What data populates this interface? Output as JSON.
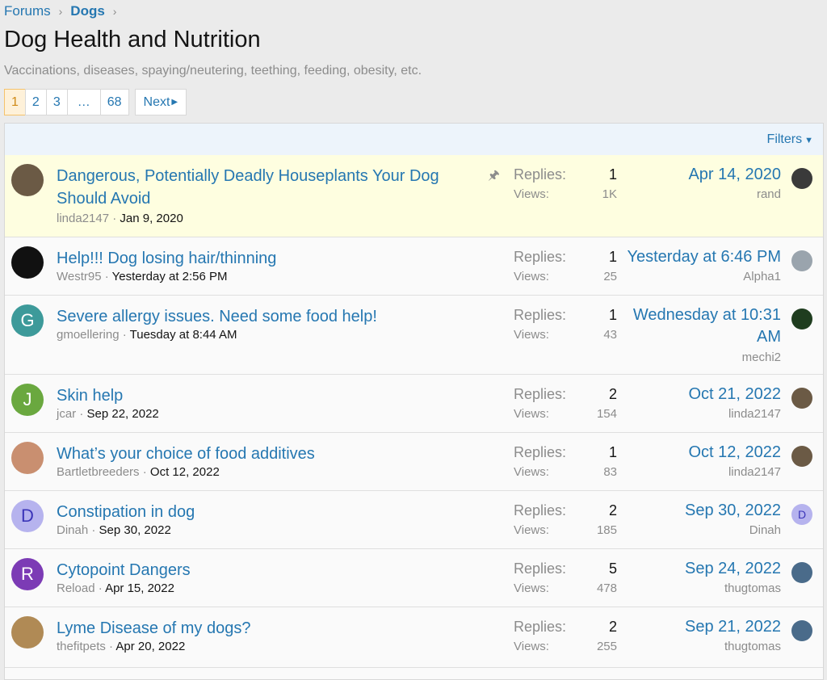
{
  "breadcrumb": {
    "forums": "Forums",
    "dogs": "Dogs",
    "sep": "›"
  },
  "page": {
    "title": "Dog Health and Nutrition",
    "description": "Vaccinations, diseases, spaying/neutering, teething, feeding, obesity, etc."
  },
  "pagination": {
    "pages": [
      "1",
      "2",
      "3",
      "…",
      "68"
    ],
    "current": "1",
    "next": "Next"
  },
  "filters": {
    "label": "Filters"
  },
  "labels": {
    "replies": "Replies:",
    "views": "Views:"
  },
  "threads": [
    {
      "title": "Dangerous, Potentially Deadly Houseplants Your Dog Should Avoid",
      "author": "linda2147",
      "date": "Jan 9, 2020",
      "replies": "1",
      "views": "1K",
      "last_date": "Apr 14, 2020",
      "last_user": "rand",
      "sticky": true,
      "avatar": {
        "letter": "",
        "color": "#6b5a45",
        "icon": "dog-photo-icon"
      },
      "last_avatar": {
        "letter": "",
        "color": "#3a3a3a",
        "icon": "pug-photo-icon"
      }
    },
    {
      "title": "Help!!! Dog losing hair/thinning",
      "author": "Westr95",
      "date": "Yesterday at 2:56 PM",
      "replies": "1",
      "views": "25",
      "last_date": "Yesterday at 6:46 PM",
      "last_user": "Alpha1",
      "sticky": false,
      "avatar": {
        "letter": "",
        "color": "#111111",
        "icon": "logo-avatar-icon"
      },
      "last_avatar": {
        "letter": "",
        "color": "#9aa4ad",
        "icon": "dog-photo-icon"
      }
    },
    {
      "title": "Severe allergy issues. Need some food help!",
      "author": "gmoellering",
      "date": "Tuesday at 8:44 AM",
      "replies": "1",
      "views": "43",
      "last_date": "Wednesday at 10:31 AM",
      "last_user": "mechi2",
      "sticky": false,
      "avatar": {
        "letter": "G",
        "color": "#3d9a9a",
        "icon": "letter-avatar-icon"
      },
      "last_avatar": {
        "letter": "",
        "color": "#1f3d1f",
        "icon": "dog-photo-icon"
      }
    },
    {
      "title": "Skin help",
      "author": "jcar",
      "date": "Sep 22, 2022",
      "replies": "2",
      "views": "154",
      "last_date": "Oct 21, 2022",
      "last_user": "linda2147",
      "sticky": false,
      "avatar": {
        "letter": "J",
        "color": "#6aa83f",
        "icon": "letter-avatar-icon"
      },
      "last_avatar": {
        "letter": "",
        "color": "#6b5a45",
        "icon": "dog-photo-icon"
      }
    },
    {
      "title": "What’s your choice of food additives",
      "author": "Bartletbreeders",
      "date": "Oct 12, 2022",
      "replies": "1",
      "views": "83",
      "last_date": "Oct 12, 2022",
      "last_user": "linda2147",
      "sticky": false,
      "avatar": {
        "letter": "",
        "color": "#c98f70",
        "icon": "person-photo-icon"
      },
      "last_avatar": {
        "letter": "",
        "color": "#6b5a45",
        "icon": "dog-photo-icon"
      }
    },
    {
      "title": "Constipation in dog",
      "author": "Dinah",
      "date": "Sep 30, 2022",
      "replies": "2",
      "views": "185",
      "last_date": "Sep 30, 2022",
      "last_user": "Dinah",
      "sticky": false,
      "avatar": {
        "letter": "D",
        "color": "#b6b3ee",
        "fg": "#3b35b8",
        "icon": "letter-avatar-icon"
      },
      "last_avatar": {
        "letter": "D",
        "color": "#b6b3ee",
        "fg": "#3b35b8",
        "icon": "letter-avatar-icon"
      }
    },
    {
      "title": "Cytopoint Dangers",
      "author": "Reload",
      "date": "Apr 15, 2022",
      "replies": "5",
      "views": "478",
      "last_date": "Sep 24, 2022",
      "last_user": "thugtomas",
      "sticky": false,
      "avatar": {
        "letter": "R",
        "color": "#7c3bb5",
        "icon": "letter-avatar-icon"
      },
      "last_avatar": {
        "letter": "",
        "color": "#4a6b8a",
        "icon": "person-photo-icon"
      }
    },
    {
      "title": "Lyme Disease of my dogs?",
      "author": "thefitpets",
      "date": "Apr 20, 2022",
      "replies": "2",
      "views": "255",
      "last_date": "Sep 21, 2022",
      "last_user": "thugtomas",
      "sticky": false,
      "avatar": {
        "letter": "",
        "color": "#b08a55",
        "icon": "dog-photo-icon"
      },
      "last_avatar": {
        "letter": "",
        "color": "#4a6b8a",
        "icon": "person-photo-icon"
      }
    }
  ]
}
